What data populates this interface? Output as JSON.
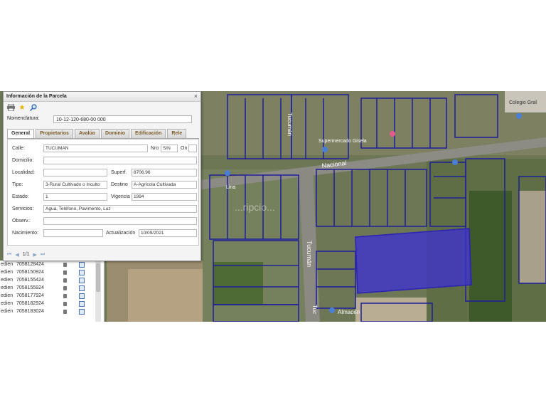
{
  "map": {
    "labels": {
      "street_nacional": "Nacional",
      "street_tucuman_top": "Tucumán",
      "street_tucuman_mid": "Tucumán",
      "street_tucuman_low": "Tuc",
      "poi_super": "Supermercado Gisela",
      "poi_colegio": "Colegio Gral",
      "poi_almacen": "Almacen",
      "poi_left": "Lina",
      "watermark": "...ripcio..."
    },
    "highlight_color": "#3c2fd6",
    "parcel_line_color": "#1e1e9a"
  },
  "list": {
    "rows": [
      {
        "c1": "edien",
        "c2": "7058128424"
      },
      {
        "c1": "edien",
        "c2": "7058150924"
      },
      {
        "c1": "edien",
        "c2": "7058155424"
      },
      {
        "c1": "edien",
        "c2": "7058155924"
      },
      {
        "c1": "edien",
        "c2": "7058177924"
      },
      {
        "c1": "edien",
        "c2": "7058182924"
      },
      {
        "c1": "edien",
        "c2": "7058183024"
      }
    ]
  },
  "dialog": {
    "title": "Información de la Parcela",
    "close": "×",
    "tools": {
      "print": "printer-icon",
      "favorite": "star-icon",
      "search": "magnifier-icon"
    },
    "nomenclatura_label": "Nomenclatura:",
    "nomenclatura_value": "10-12-120-680-00 000",
    "tabs": [
      "General",
      "Propietarios",
      "Avalúo",
      "Dominio",
      "Edificación",
      "Rele"
    ],
    "form": {
      "calle_label": "Calle:",
      "calle_value": "TUCUMAN",
      "nro_label": "Nro",
      "nro_value": "S/N",
      "on_label": "On",
      "on_value": "",
      "domicilio_label": "Domicilio:",
      "domicilio_value": "",
      "localidad_label": "Localidad:",
      "localidad_value": "",
      "superf_label": "Superf.",
      "superf_value": "8706.96",
      "tipo_label": "Tipo:",
      "tipo_value": "3-Rural Cultivado o Inculto",
      "destino_label": "Destino",
      "destino_value": "A-Agrícola Cultivada",
      "estado_label": "Estado:",
      "estado_value": "1",
      "vigencia_label": "Vigencia",
      "vigencia_value": "1994",
      "servicios_label": "Servicios:",
      "servicios_value": "Agua, Teléfono, Pavimento, Luz",
      "observ_label": "Observ.:",
      "observ_value": "",
      "nacimiento_label": "Nacimiento:",
      "nacimiento_value": "",
      "actualizacion_label": "Actualización",
      "actualizacion_value": "10/09/2021"
    },
    "pager": {
      "text": "1/1"
    }
  }
}
